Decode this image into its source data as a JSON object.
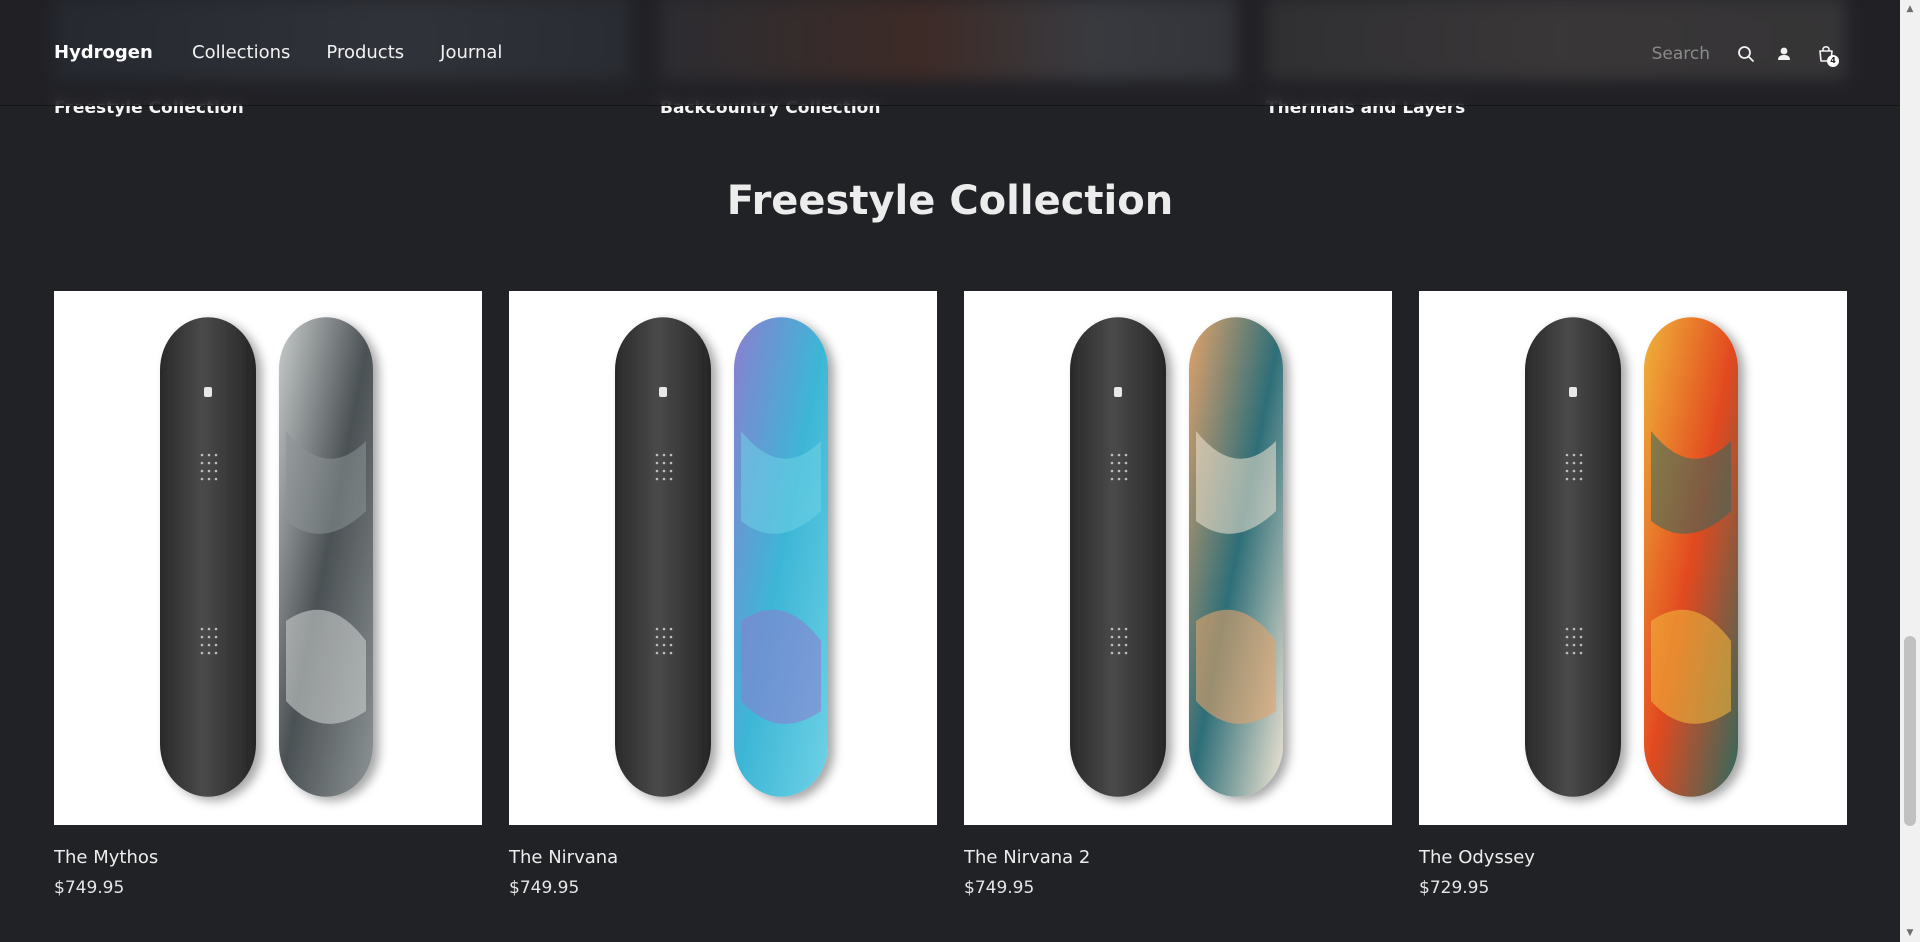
{
  "header": {
    "brand": "Hydrogen",
    "nav": [
      "Collections",
      "Products",
      "Journal"
    ],
    "search_placeholder": "Search",
    "cart_count": "4",
    "icons": [
      "search-icon",
      "account-icon",
      "cart-icon"
    ]
  },
  "collections_strip": {
    "labels": [
      "Freestyle Collection",
      "Backcountry Collection",
      "Thermals and Layers"
    ]
  },
  "section": {
    "title": "Freestyle Collection"
  },
  "products": [
    {
      "title": "The Mythos",
      "price": "$749.95",
      "palette": [
        "#4b5154",
        "#c9cdcd",
        "#8d9495"
      ]
    },
    {
      "title": "The Nirvana",
      "price": "$749.95",
      "palette": [
        "#3db6d6",
        "#8a7fd0",
        "#6fd2e6"
      ]
    },
    {
      "title": "The Nirvana 2",
      "price": "$749.95",
      "palette": [
        "#2e6e78",
        "#e3a36a",
        "#f1e6d4"
      ]
    },
    {
      "title": "The Odyssey",
      "price": "$729.95",
      "palette": [
        "#e24a1f",
        "#f0b43a",
        "#2f6a5e"
      ]
    }
  ],
  "colors": {
    "background": "#212226",
    "card_background": "#ffffff",
    "text": "#e8e8e8"
  }
}
